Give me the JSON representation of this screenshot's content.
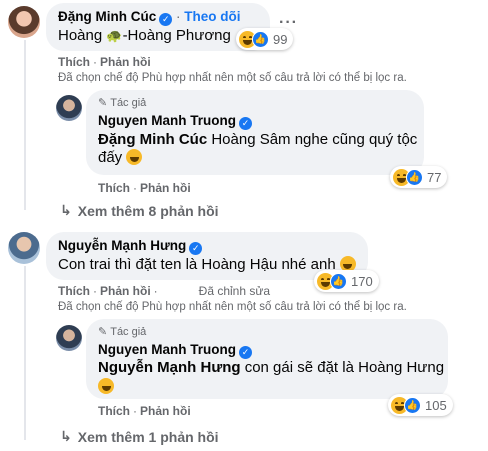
{
  "colors": {
    "accent": "#1877f2",
    "bubble": "#f0f2f5",
    "meta": "#65676b"
  },
  "c1": {
    "name": "Đặng Minh Cúc",
    "follow_sep": "·",
    "follow": "Theo dõi",
    "text_a": "Hoàng ",
    "emoji_turtle": "🐢",
    "text_b": "-Hoàng Phương",
    "reaction_count": "99",
    "actions": {
      "like": "Thích",
      "sep": "·",
      "reply": "Phản hồi"
    },
    "filter_note": "Đã chọn chế độ Phù hợp nhất nên một số câu trả lời có thể bị lọc ra."
  },
  "r1": {
    "author_tag": "Tác giả",
    "name": "Nguyen Manh Truong",
    "mention": "Đặng Minh Cúc",
    "text_line1": " Hoàng Sâm nghe cũng quý tộc",
    "text_line2": "đấy",
    "reaction_count": "77",
    "actions": {
      "like": "Thích",
      "sep": "·",
      "reply": "Phản hồi"
    }
  },
  "more1": "Xem thêm 8 phản hồi",
  "c2": {
    "name": "Nguyễn Mạnh Hưng",
    "text": "Con trai thì đặt ten là Hoàng Hậu nhé anh",
    "reaction_count": "170",
    "actions": {
      "like": "Thích",
      "sep": "·",
      "reply": "Phản hồi",
      "edited": "Đã chỉnh sửa"
    },
    "filter_note": "Đã chọn chế độ Phù hợp nhất nên một số câu trả lời có thể bị lọc ra."
  },
  "r2": {
    "author_tag": "Tác giả",
    "name": "Nguyen Manh Truong",
    "mention": "Nguyễn Mạnh Hưng",
    "text": " con gái sẽ đặt là Hoàng Hưng",
    "reaction_count": "105",
    "actions": {
      "like": "Thích",
      "sep": "·",
      "reply": "Phản hồi"
    }
  },
  "more2": "Xem thêm 1 phản hồi",
  "icons": {
    "more": "more-horizontal-icon",
    "reply_arrow": "reply-arrow-icon",
    "verified": "verified-badge-icon",
    "author_tag": "pencil-icon",
    "reactions": [
      "haha-icon",
      "like-icon"
    ]
  }
}
